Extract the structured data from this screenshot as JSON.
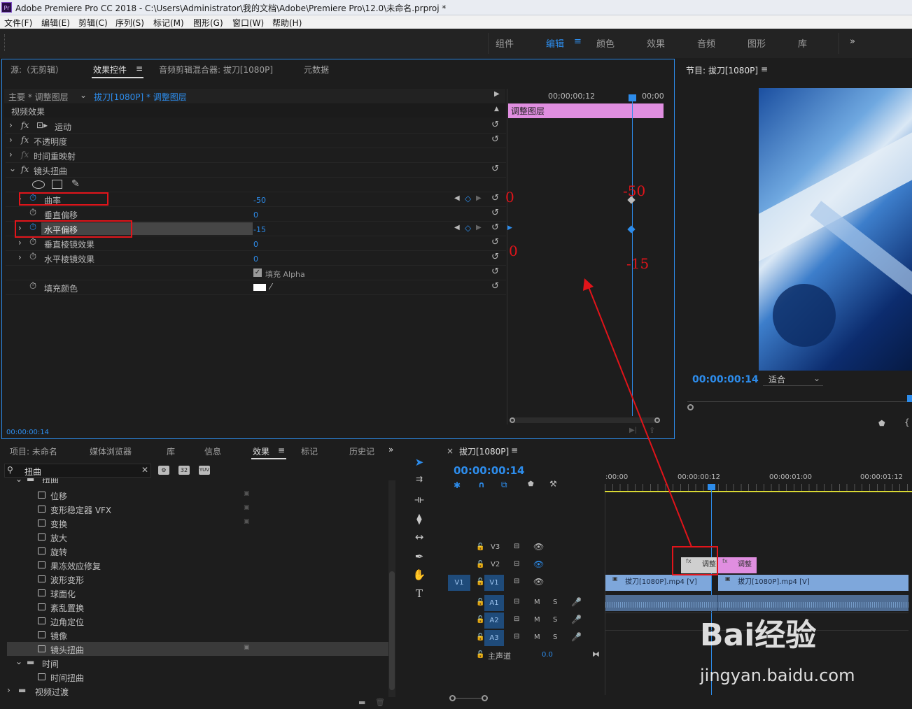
{
  "titlebar": {
    "icon": "Pr",
    "title": "Adobe Premiere Pro CC 2018 - C:\\Users\\Administrator\\我的文档\\Adobe\\Premiere Pro\\12.0\\未命名.prproj *"
  },
  "menu": [
    "文件(F)",
    "编辑(E)",
    "剪辑(C)",
    "序列(S)",
    "标记(M)",
    "图形(G)",
    "窗口(W)",
    "帮助(H)"
  ],
  "workspaces": [
    "组件",
    "编辑",
    "颜色",
    "效果",
    "音频",
    "图形",
    "库"
  ],
  "ws_more": "»",
  "ec": {
    "tabs": [
      "源:（无剪辑）",
      "效果控件",
      "音频剪辑混合器: 拔刀[1080P]",
      "元数据"
    ],
    "master": "主要 * 调整图层",
    "clipsel": "拔刀[1080P] * 调整图层",
    "section": "视频效果",
    "effects": [
      "运动",
      "不透明度",
      "时间重映射",
      "镜头扭曲"
    ],
    "params": [
      {
        "name": "曲率",
        "value": "-50"
      },
      {
        "name": "垂直偏移",
        "value": "0"
      },
      {
        "name": "水平偏移",
        "value": "-15"
      },
      {
        "name": "垂直棱镜效果",
        "value": "0"
      },
      {
        "name": "水平棱镜效果",
        "value": "0"
      }
    ],
    "fill_alpha": "填充 Alpha",
    "fill_color": "填充颜色",
    "mini_tc": "00;00;00;12",
    "mini_tc2": "00;00",
    "clip_bar": "调整图层",
    "bottom_tc": "00:00:00:14",
    "annot": [
      "0",
      "-50",
      "0",
      "-15"
    ]
  },
  "program": {
    "title": "节目: 拔刀[1080P]",
    "timecode": "00:00:00:14",
    "fit": "适合"
  },
  "project": {
    "tabs": [
      "项目: 未命名",
      "媒体浏览器",
      "库",
      "信息",
      "效果",
      "标记",
      "历史记"
    ],
    "search": "扭曲",
    "folder_top": "扭曲",
    "items": [
      "位移",
      "变形稳定器 VFX",
      "变换",
      "放大",
      "旋转",
      "果冻效应修复",
      "波形变形",
      "球面化",
      "紊乱置换",
      "边角定位",
      "镜像",
      "镜头扭曲"
    ],
    "folder2": "时间",
    "item2": "时间扭曲",
    "folder3": "视频过渡",
    "icons": [
      "32",
      "YUV"
    ]
  },
  "timeline": {
    "title": "拔刀[1080P]",
    "timecode": "00:00:00:14",
    "ruler": [
      ":00:00",
      "00:00:00:12",
      "00:00:01:00",
      "00:00:01:12"
    ],
    "tracks": [
      {
        "name": "V3",
        "src": ""
      },
      {
        "name": "V2",
        "src": ""
      },
      {
        "name": "V1",
        "src": "V1"
      },
      {
        "name": "A1",
        "src": ""
      },
      {
        "name": "A2",
        "src": ""
      },
      {
        "name": "A3",
        "src": ""
      }
    ],
    "master": "主声道",
    "master_val": "0.0",
    "clips_v1": [
      "拔刀[1080P].mp4 [V]",
      "拔刀[1080P].mp4 [V]"
    ],
    "clips_v2": [
      "调整",
      "调整"
    ],
    "mute": "M",
    "solo": "S"
  },
  "watermark": {
    "line1": "Bai经验",
    "line2": "jingyan.baidu.com"
  },
  "colors": {
    "accent": "#2d8ceb",
    "annotation": "#e1141a",
    "adjustment_clip": "#e08ee0",
    "video_clip": "#7ea7db"
  }
}
